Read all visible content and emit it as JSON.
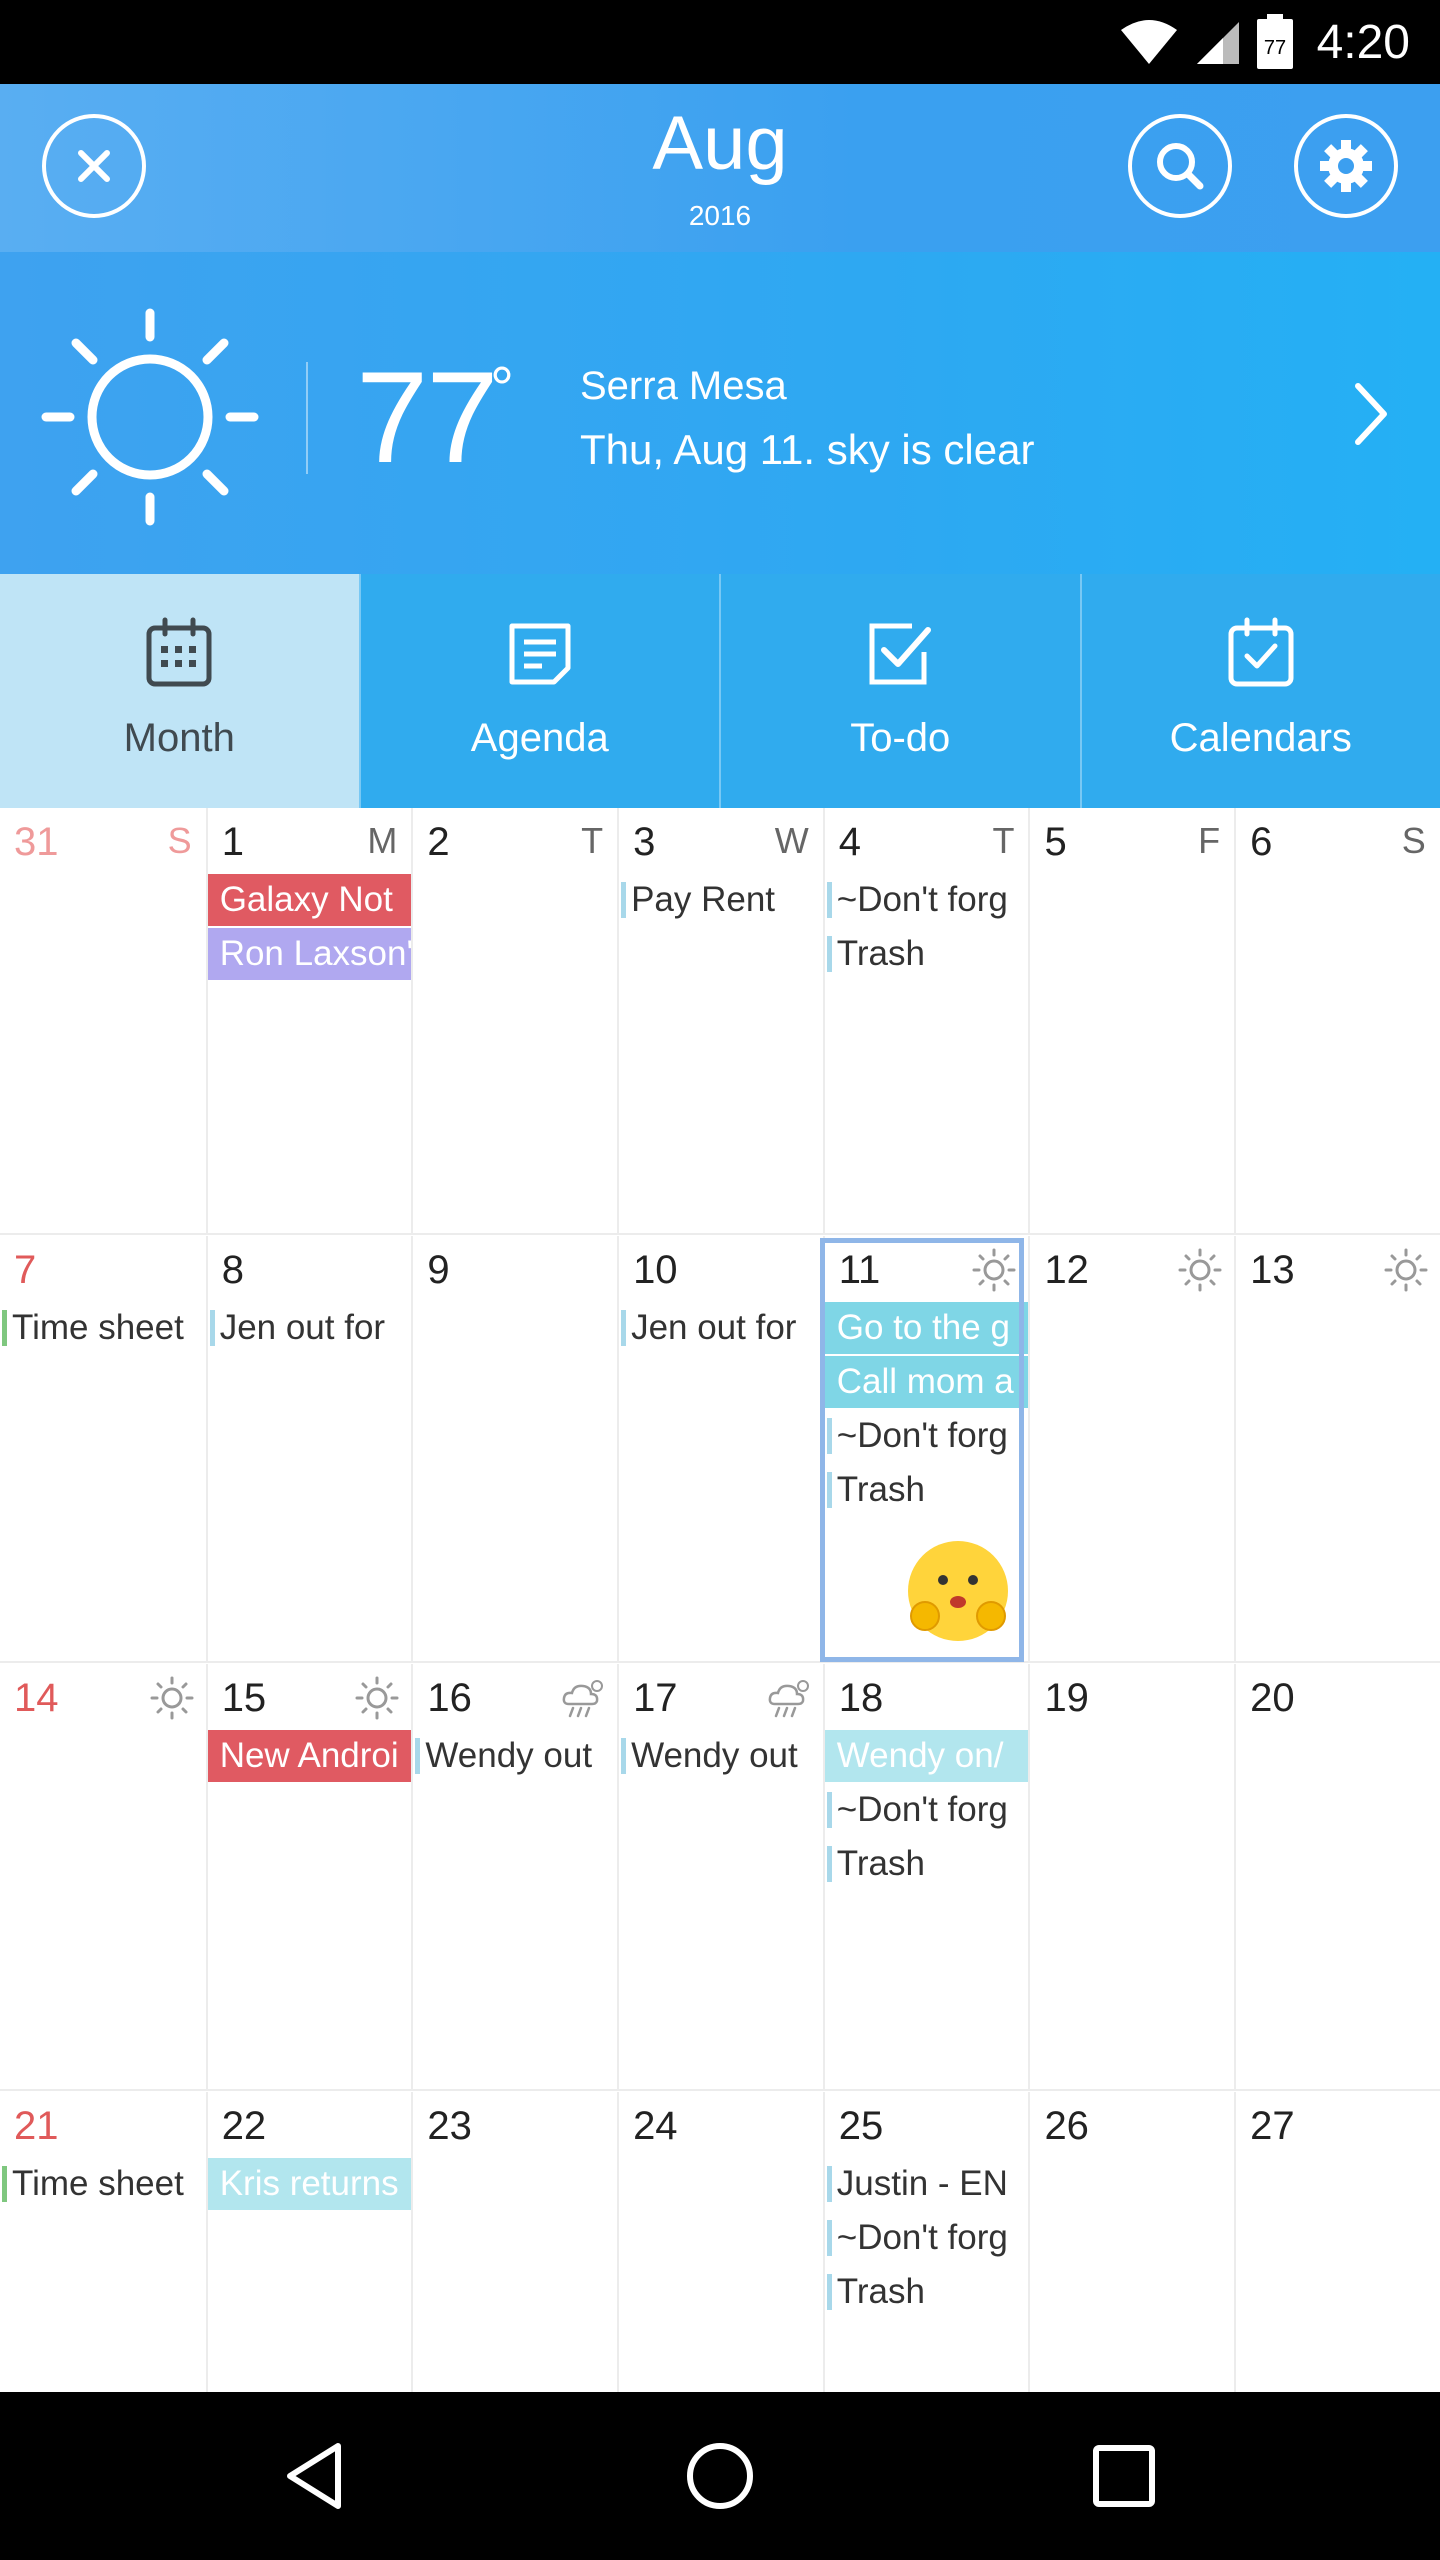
{
  "status_bar": {
    "time": "4:20",
    "battery_level": "77",
    "icons": [
      "wifi-icon",
      "signal-icon",
      "battery-icon"
    ]
  },
  "header": {
    "month": "Aug",
    "year": "2016",
    "close_icon": "close-icon",
    "search_icon": "search-icon",
    "settings_icon": "gear-icon"
  },
  "weather": {
    "temperature": "77",
    "degree_symbol": "°",
    "location": "Serra Mesa",
    "description": "Thu, Aug 11. sky is clear",
    "icon": "sun-icon"
  },
  "tabs": [
    {
      "label": "Month",
      "icon": "calendar-grid-icon",
      "active": true
    },
    {
      "label": "Agenda",
      "icon": "agenda-icon",
      "active": false
    },
    {
      "label": "To-do",
      "icon": "checkbox-icon",
      "active": false
    },
    {
      "label": "Calendars",
      "icon": "calendar-check-icon",
      "active": false
    }
  ],
  "weekday_initials": [
    "S",
    "M",
    "T",
    "W",
    "T",
    "F",
    "S"
  ],
  "colors": {
    "header_bg": "#3c9ff0",
    "tab_active_bg": "#bfe4f6",
    "event_red": "#e05a62",
    "event_purple": "#b0a8f0",
    "event_teal": "#7fd6e6",
    "event_light_teal": "#b2e6ee",
    "today_border": "#8fb6e8",
    "sunday_red": "#e05a5a"
  },
  "weeks": [
    {
      "days": [
        {
          "num": "31",
          "prev_month": true,
          "events": []
        },
        {
          "num": "1",
          "events": [
            {
              "title": "Galaxy Not",
              "style": "filled",
              "color": "#e05a62"
            },
            {
              "title": "Ron Laxson'",
              "style": "filled",
              "color": "#b0a8f0"
            }
          ]
        },
        {
          "num": "2",
          "events": []
        },
        {
          "num": "3",
          "events": [
            {
              "title": "Pay Rent",
              "style": "bar"
            }
          ]
        },
        {
          "num": "4",
          "events": [
            {
              "title": "~Don't forg",
              "style": "bar"
            },
            {
              "title": "Trash",
              "style": "bar"
            }
          ]
        },
        {
          "num": "5",
          "events": []
        },
        {
          "num": "6",
          "events": []
        }
      ]
    },
    {
      "days": [
        {
          "num": "7",
          "events": [
            {
              "title": "Time sheet",
              "style": "bar",
              "bar_color": "green"
            }
          ]
        },
        {
          "num": "8",
          "events": [
            {
              "title": "Jen out for",
              "style": "bar"
            }
          ]
        },
        {
          "num": "9",
          "events": []
        },
        {
          "num": "10",
          "events": [
            {
              "title": "Jen out for",
              "style": "bar"
            }
          ]
        },
        {
          "num": "11",
          "today": true,
          "weather": "sun",
          "events": [
            {
              "title": "Go to the g",
              "style": "filled",
              "color": "#7fd6e6"
            },
            {
              "title": "Call mom a",
              "style": "filled",
              "color": "#7fd6e6"
            },
            {
              "title": "~Don't forg",
              "style": "bar"
            },
            {
              "title": "Trash",
              "style": "bar"
            }
          ],
          "sticker": "emoji-sticker"
        },
        {
          "num": "12",
          "weather": "sun",
          "events": []
        },
        {
          "num": "13",
          "weather": "sun",
          "events": []
        }
      ]
    },
    {
      "days": [
        {
          "num": "14",
          "weather": "sun",
          "events": []
        },
        {
          "num": "15",
          "weather": "sun",
          "events": [
            {
              "title": "New Androi",
              "style": "filled",
              "color": "#e05a62"
            }
          ]
        },
        {
          "num": "16",
          "weather": "storm",
          "events": [
            {
              "title": "Wendy out",
              "style": "bar"
            }
          ]
        },
        {
          "num": "17",
          "weather": "storm",
          "events": [
            {
              "title": "Wendy out",
              "style": "bar"
            }
          ]
        },
        {
          "num": "18",
          "events": [
            {
              "title": "Wendy on/",
              "style": "filled",
              "color": "#b2e6ee"
            },
            {
              "title": "~Don't forg",
              "style": "bar"
            },
            {
              "title": "Trash",
              "style": "bar"
            }
          ]
        },
        {
          "num": "19",
          "events": []
        },
        {
          "num": "20",
          "events": []
        }
      ]
    },
    {
      "days": [
        {
          "num": "21",
          "events": [
            {
              "title": "Time sheet",
              "style": "bar",
              "bar_color": "green"
            }
          ]
        },
        {
          "num": "22",
          "events": [
            {
              "title": "Kris returns",
              "style": "filled",
              "color": "#b2e6ee"
            }
          ]
        },
        {
          "num": "23",
          "events": []
        },
        {
          "num": "24",
          "events": []
        },
        {
          "num": "25",
          "events": [
            {
              "title": "Justin - EN",
              "style": "bar"
            },
            {
              "title": "~Don't forg",
              "style": "bar"
            },
            {
              "title": "Trash",
              "style": "bar"
            }
          ]
        },
        {
          "num": "26",
          "events": []
        },
        {
          "num": "27",
          "events": []
        }
      ]
    }
  ],
  "navbar": {
    "back": "back-icon",
    "home": "home-icon",
    "recents": "recents-icon"
  }
}
